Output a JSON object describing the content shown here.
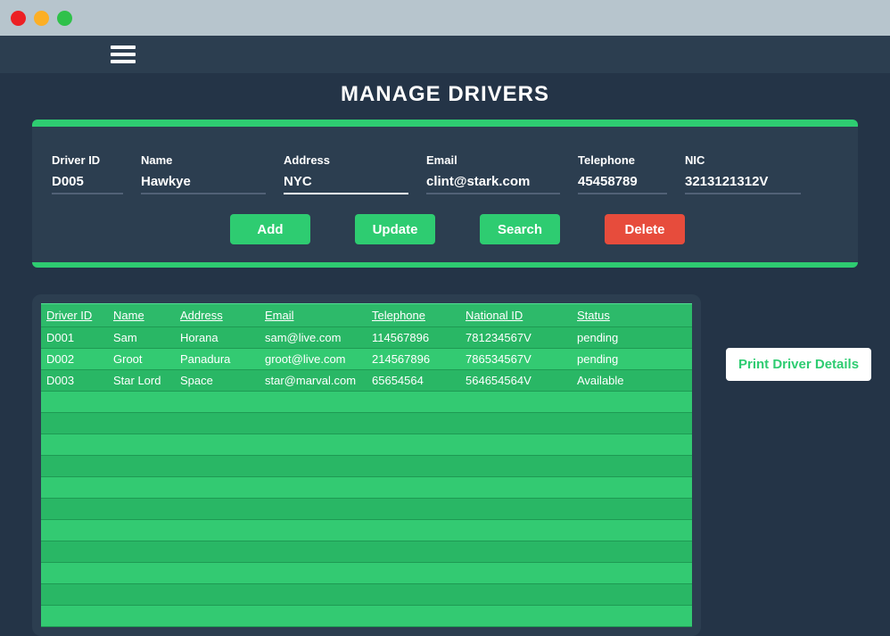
{
  "page": {
    "title": "MANAGE DRIVERS"
  },
  "form": {
    "driver_id": {
      "label": "Driver ID",
      "value": "D005"
    },
    "name": {
      "label": "Name",
      "value": "Hawkye"
    },
    "address": {
      "label": "Address",
      "value": "NYC"
    },
    "email": {
      "label": "Email",
      "value": "clint@stark.com"
    },
    "telephone": {
      "label": "Telephone",
      "value": "45458789"
    },
    "nic": {
      "label": "NIC",
      "value": "3213121312V"
    }
  },
  "buttons": {
    "add": "Add",
    "update": "Update",
    "search": "Search",
    "delete": "Delete",
    "print": "Print Driver Details"
  },
  "table": {
    "headers": {
      "driver_id": "Driver ID",
      "name": "Name",
      "address": "Address",
      "email": "Email",
      "telephone": "Telephone",
      "national_id": "National ID",
      "status": "Status"
    },
    "rows": [
      {
        "driver_id": "D001",
        "name": "Sam",
        "address": "Horana",
        "email": "sam@live.com",
        "telephone": "114567896",
        "national_id": "781234567V",
        "status": "pending"
      },
      {
        "driver_id": "D002",
        "name": "Groot",
        "address": "Panadura",
        "email": "groot@live.com",
        "telephone": "214567896",
        "national_id": "786534567V",
        "status": "pending"
      },
      {
        "driver_id": "D003",
        "name": "Star Lord",
        "address": "Space",
        "email": "star@marval.com",
        "telephone": "65654564",
        "national_id": "564654564V",
        "status": "Available"
      }
    ],
    "empty_row_count": 11
  },
  "colors": {
    "bg": "#243447",
    "panel": "#2c3e50",
    "accent": "#2ecc71",
    "danger": "#e74c3c",
    "table_odd": "#29b765",
    "table_even": "#33ca72"
  }
}
